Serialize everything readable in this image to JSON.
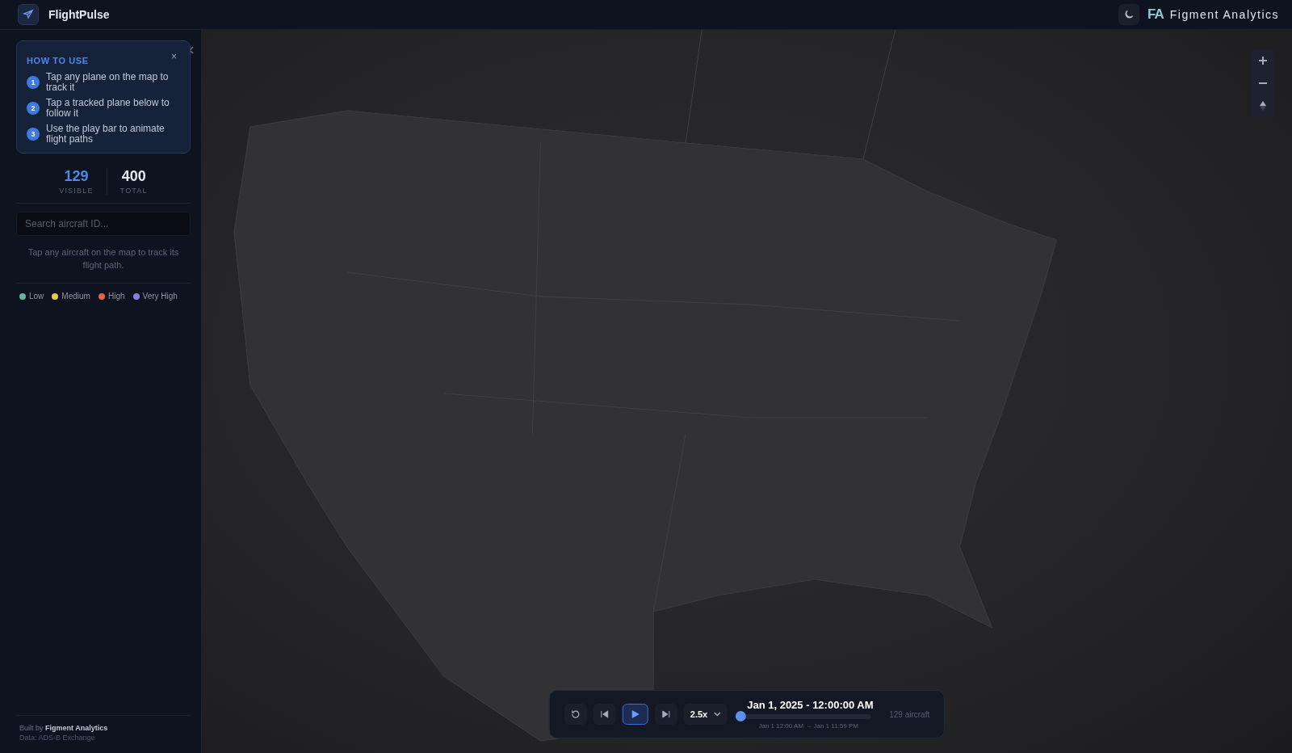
{
  "app": {
    "title": "FlightPulse"
  },
  "brand": {
    "logo": "FA",
    "name": "Figment Analytics"
  },
  "how_to_use": {
    "title": "HOW TO USE",
    "close": "×",
    "steps": [
      {
        "number": "1",
        "text": "Tap any plane on the map to track it"
      },
      {
        "number": "2",
        "text": "Tap a tracked plane below to follow it"
      },
      {
        "number": "3",
        "text": "Use the play bar to animate flight paths"
      }
    ]
  },
  "stats": [
    {
      "value": "129",
      "label": "VISIBLE",
      "kind": "accent"
    },
    {
      "value": "400",
      "label": "TOTAL",
      "kind": "plain"
    }
  ],
  "search": {
    "placeholder": "Search aircraft ID..."
  },
  "hint": "Tap any aircraft on the map to track its flight path.",
  "legend": [
    {
      "label": "Low",
      "color": "#5fb8a0"
    },
    {
      "label": "Medium",
      "color": "#e8c94a"
    },
    {
      "label": "High",
      "color": "#e0643c"
    },
    {
      "label": "Very High",
      "color": "#8b7ee0"
    }
  ],
  "footer": {
    "credit": "Built by **Figment Analytics**",
    "source": "Data: ADS-B Exchange"
  },
  "playback": {
    "speed": "2.5x",
    "datetime": "Jan 1, 2025 - 12:00:00 AM",
    "range": "Jan 1 12:00 AM → Jan 1 11:59 PM",
    "level": 0,
    "count": "129 aircraft"
  }
}
